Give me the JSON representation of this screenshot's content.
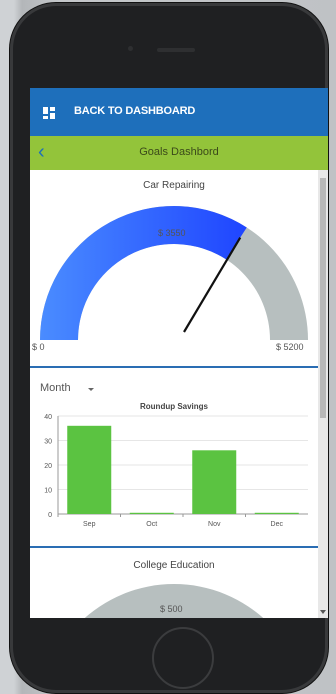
{
  "topbar": {
    "back_label": "BACK TO DASHBOARD"
  },
  "subbar": {
    "title": "Goals Dashbord",
    "back_icon": "chevron-left-icon"
  },
  "goal1": {
    "title": "Car Repairing",
    "current_label": "$ 3550",
    "min_label": "$ 0",
    "max_label": "$ 5200",
    "current": 3550,
    "min": 0,
    "max": 5200,
    "fill_color": "#2f6bff",
    "track_color": "#b7bfbf"
  },
  "filter": {
    "period": "Month"
  },
  "chart_data": {
    "type": "bar",
    "title": "Roundup Savings",
    "categories": [
      "Sep",
      "Oct",
      "Nov",
      "Dec"
    ],
    "values": [
      36,
      0.5,
      26,
      0.5
    ],
    "ylim": [
      0,
      40
    ],
    "yticks": [
      "0",
      "10",
      "20",
      "30",
      "40"
    ],
    "bar_color": "#5bc341",
    "grid": true
  },
  "goal2": {
    "title": "College Education",
    "current_label": "$ 500",
    "track_color": "#b7bfbf"
  },
  "colors": {
    "topbar": "#1e6fbb",
    "subbar": "#93c43a",
    "divider": "#2a6db3"
  }
}
